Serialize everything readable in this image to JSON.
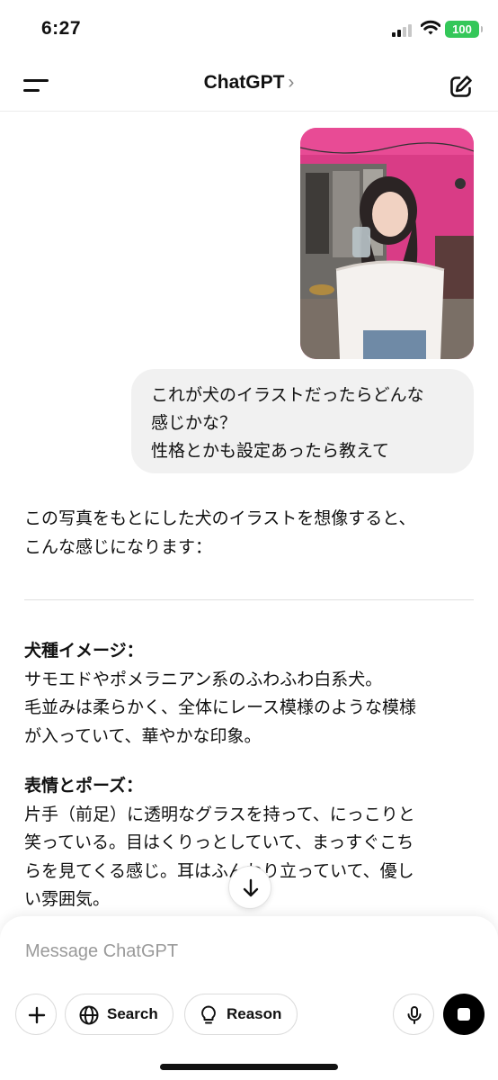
{
  "status_bar": {
    "time": "6:27",
    "battery": "100",
    "icons": [
      "signal-icon",
      "wifi-icon",
      "battery-icon"
    ],
    "battery_color": "#34c759"
  },
  "header": {
    "title": "ChatGPT",
    "chevron": "›",
    "icons": [
      "menu-icon",
      "new-chat-icon"
    ]
  },
  "chat": {
    "user_message": {
      "image_icon": "photo-of-woman-in-white-lace-top-holding-glass",
      "lines": [
        "これが犬のイラストだったらどんな",
        "感じかな？",
        "性格とかも設定あったら教えて"
      ]
    },
    "assistant_message": {
      "intro": [
        "この写真をもとにした犬のイラストを想像すると、",
        "こんな感じになります："
      ],
      "sections": [
        {
          "heading": "犬種イメージ：",
          "lines": [
            "サモエドやポメラニアン系のふわふわ白系犬。",
            "毛並みは柔らかく、全体にレース模様のような模様",
            "が入っていて、華やかな印象。"
          ]
        },
        {
          "heading": "表情とポーズ：",
          "lines": [
            "片手（前足）に透明なグラスを持って、にっこりと",
            "笑っている。目はくりっとしていて、まっすぐこち",
            "らを見てくる感じ。耳はふんわり立っていて、優し",
            "い雰囲気。"
          ]
        }
      ]
    },
    "scroll_down_icon": "arrow-down-icon"
  },
  "composer": {
    "placeholder": "Message ChatGPT",
    "buttons": {
      "add_icon": "plus-icon",
      "search_label": "Search",
      "search_icon": "globe-icon",
      "reason_label": "Reason",
      "reason_icon": "lightbulb-icon",
      "mic_icon": "microphone-icon",
      "stop_icon": "stop-icon"
    }
  }
}
